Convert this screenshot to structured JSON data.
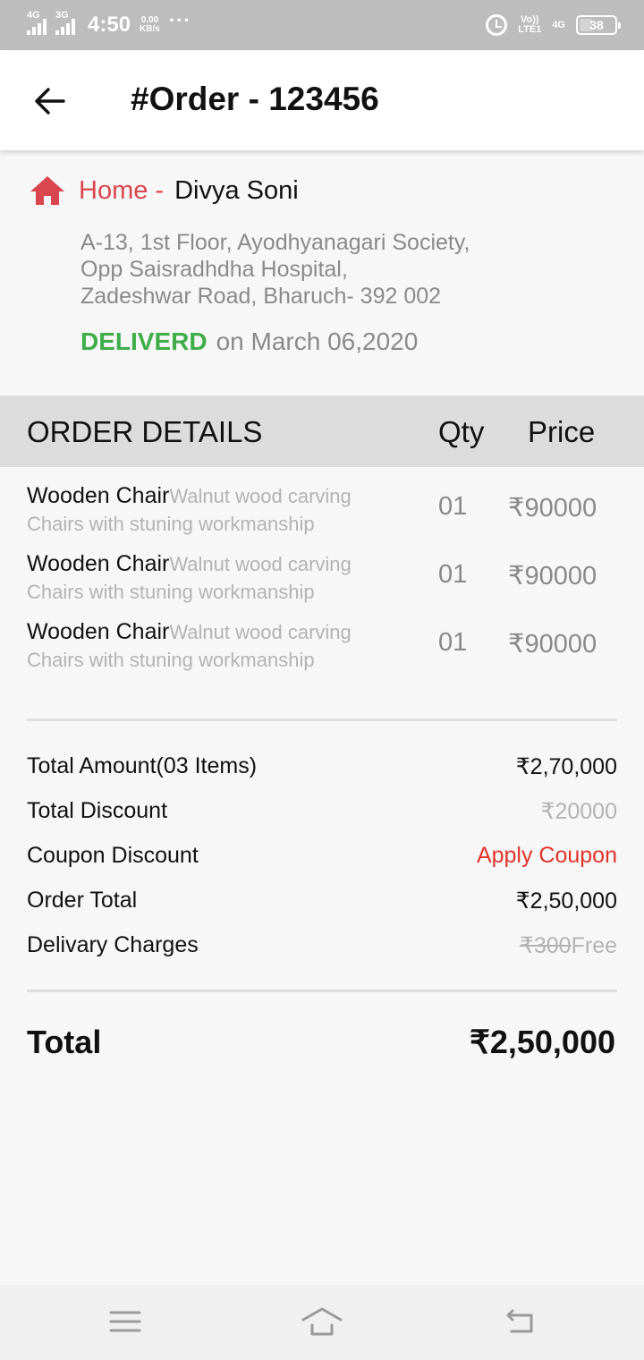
{
  "status_bar": {
    "net1": "4G",
    "net2": "3G",
    "time": "4:50",
    "speed_value": "0.00",
    "speed_unit": "KB/s",
    "more": "···",
    "volte_line1": "Vo))",
    "volte_line2": "LTE1",
    "net3": "4G",
    "battery": "38"
  },
  "header": {
    "title": "#Order - 123456"
  },
  "address": {
    "type": "Home -",
    "name": "Divya Soni",
    "lines": [
      "A-13, 1st Floor, Ayodhyanagari Society,",
      "Opp Saisradhdha Hospital,",
      "Zadeshwar Road, Bharuch- 392 002"
    ],
    "status": "DELIVERD",
    "date": "on March 06,2020"
  },
  "order_details": {
    "title": "ORDER DETAILS",
    "qty_header": "Qty",
    "price_header": "Price",
    "items": [
      {
        "name": "Wooden Chair",
        "desc": "Walnut wood carving Chairs with stuning workmanship",
        "qty": "01",
        "price": "₹90000"
      },
      {
        "name": "Wooden Chair",
        "desc": "Walnut wood carving Chairs with stuning workmanship",
        "qty": "01",
        "price": "₹90000"
      },
      {
        "name": "Wooden Chair",
        "desc": "Walnut wood carving Chairs with stuning workmanship",
        "qty": "01",
        "price": "₹90000"
      }
    ]
  },
  "summary": {
    "total_amount_label": "Total Amount(03 Items)",
    "total_amount_value": "₹2,70,000",
    "total_discount_label": "Total Discount",
    "total_discount_value": "₹20000",
    "coupon_label": "Coupon Discount",
    "coupon_action": "Apply Coupon",
    "order_total_label": "Order Total",
    "order_total_value": "₹2,50,000",
    "delivery_label": "Delivary Charges",
    "delivery_old": "₹300",
    "delivery_new": "Free",
    "grand_total_label": "Total",
    "grand_total_value": "₹2,50,000"
  },
  "colors": {
    "accent_red": "#d9464f",
    "delivered_green": "#3fae49",
    "coupon_red": "#e0352b",
    "muted_text": "#8a8a8a"
  },
  "icons": {
    "back": "arrow-left-icon",
    "home": "home-icon",
    "nav_menu": "menu-icon",
    "nav_home": "home-outline-icon",
    "nav_back": "return-icon"
  }
}
